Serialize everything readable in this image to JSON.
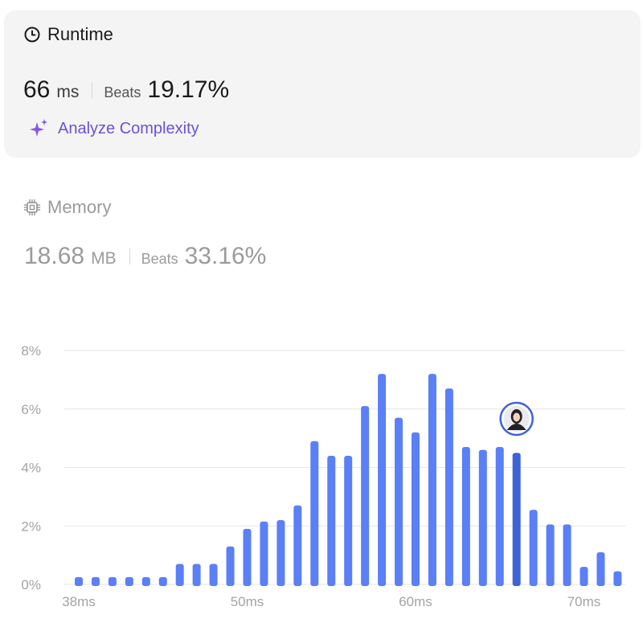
{
  "runtime": {
    "title": "Runtime",
    "value": "66",
    "unit": "ms",
    "beats_label": "Beats",
    "beats_value": "19.17%",
    "analyze_label": "Analyze Complexity"
  },
  "memory": {
    "title": "Memory",
    "value": "18.68",
    "unit": "MB",
    "beats_label": "Beats",
    "beats_value": "33.16%"
  },
  "colors": {
    "bar": "#5a7ff6",
    "bar_highlight": "#3f62d6",
    "accent": "#6a52d8",
    "axis_text": "#a3a3a3",
    "grid": "#e6e6e6"
  },
  "chart_data": {
    "type": "bar",
    "y_tick_labels": [
      "0%",
      "2%",
      "4%",
      "6%",
      "8%"
    ],
    "y_ticks": [
      0,
      2,
      4,
      6,
      8
    ],
    "ylim": [
      0,
      8
    ],
    "x_tick_labels": [
      {
        "label": "38ms",
        "index": 0
      },
      {
        "label": "50ms",
        "index": 10
      },
      {
        "label": "60ms",
        "index": 20
      },
      {
        "label": "70ms",
        "index": 30
      }
    ],
    "values": [
      0.25,
      0.25,
      0.25,
      0.25,
      0.25,
      0.25,
      0.7,
      0.7,
      0.7,
      1.3,
      1.9,
      2.15,
      2.2,
      2.7,
      4.9,
      4.4,
      4.4,
      6.1,
      7.2,
      5.7,
      5.2,
      7.2,
      6.7,
      4.7,
      4.6,
      4.7,
      4.5,
      2.55,
      2.05,
      2.05,
      0.6,
      1.1,
      0.45
    ],
    "highlight_index": 26,
    "grid": true
  }
}
